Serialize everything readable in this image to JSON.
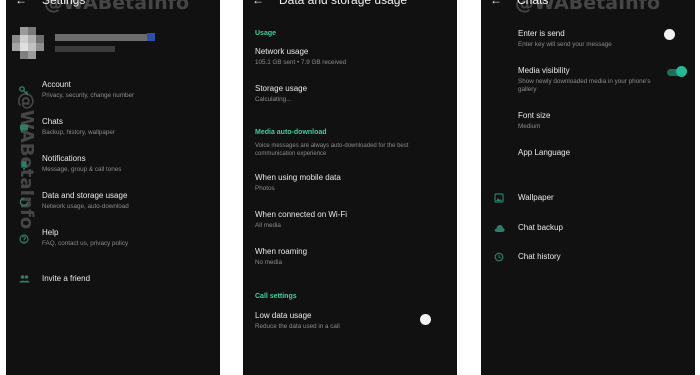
{
  "watermark": "@WABetaInfo",
  "settings": {
    "title": "Settings",
    "back_icon": "arrow-left-icon",
    "items": [
      {
        "icon": "key-icon",
        "title": "Account",
        "subtitle": "Privacy, security, change number"
      },
      {
        "icon": "chat-icon",
        "title": "Chats",
        "subtitle": "Backup, history, wallpaper"
      },
      {
        "icon": "bell-icon",
        "title": "Notifications",
        "subtitle": "Message, group & call tones"
      },
      {
        "icon": "data-usage-icon",
        "title": "Data and storage usage",
        "subtitle": "Network usage, auto-download"
      },
      {
        "icon": "help-icon",
        "title": "Help",
        "subtitle": "FAQ, contact us, privacy policy"
      },
      {
        "icon": "people-icon",
        "title": "Invite a friend",
        "subtitle": ""
      }
    ]
  },
  "data_storage": {
    "title": "Data and storage usage",
    "back_icon": "arrow-left-icon",
    "section_usage": "Usage",
    "network_usage": {
      "title": "Network usage",
      "subtitle": "105.1 GB sent • 7.9 GB received"
    },
    "storage_usage": {
      "title": "Storage usage",
      "subtitle": "Calculating..."
    },
    "section_auto_download": "Media auto-download",
    "auto_download_note": "Voice messages are always auto-downloaded for the best communication experience",
    "mobile_data": {
      "title": "When using mobile data",
      "subtitle": "Photos"
    },
    "wifi": {
      "title": "When connected on Wi-Fi",
      "subtitle": "All media"
    },
    "roaming": {
      "title": "When roaming",
      "subtitle": "No media"
    },
    "section_call": "Call settings",
    "low_data": {
      "title": "Low data usage",
      "subtitle": "Reduce the data used in a call",
      "enabled": false
    }
  },
  "chats": {
    "title": "Chats",
    "back_icon": "arrow-left-icon",
    "enter_is_send": {
      "title": "Enter is send",
      "subtitle": "Enter key will send your message",
      "enabled": false
    },
    "media_visibility": {
      "title": "Media visibility",
      "subtitle": "Show newly downloaded media in your phone's gallery",
      "enabled": true
    },
    "font_size": {
      "title": "Font size",
      "subtitle": "Medium"
    },
    "app_language": {
      "title": "App Language"
    },
    "wallpaper": {
      "icon": "wallpaper-icon",
      "title": "Wallpaper"
    },
    "chat_backup": {
      "icon": "cloud-upload-icon",
      "title": "Chat backup"
    },
    "chat_history": {
      "icon": "history-icon",
      "title": "Chat history"
    }
  },
  "colors": {
    "background": "#111111",
    "accent": "#3ecfa1",
    "icon": "#2f7c6a",
    "primary_text": "#e9e9e9",
    "secondary_text": "#8c8c8c"
  }
}
